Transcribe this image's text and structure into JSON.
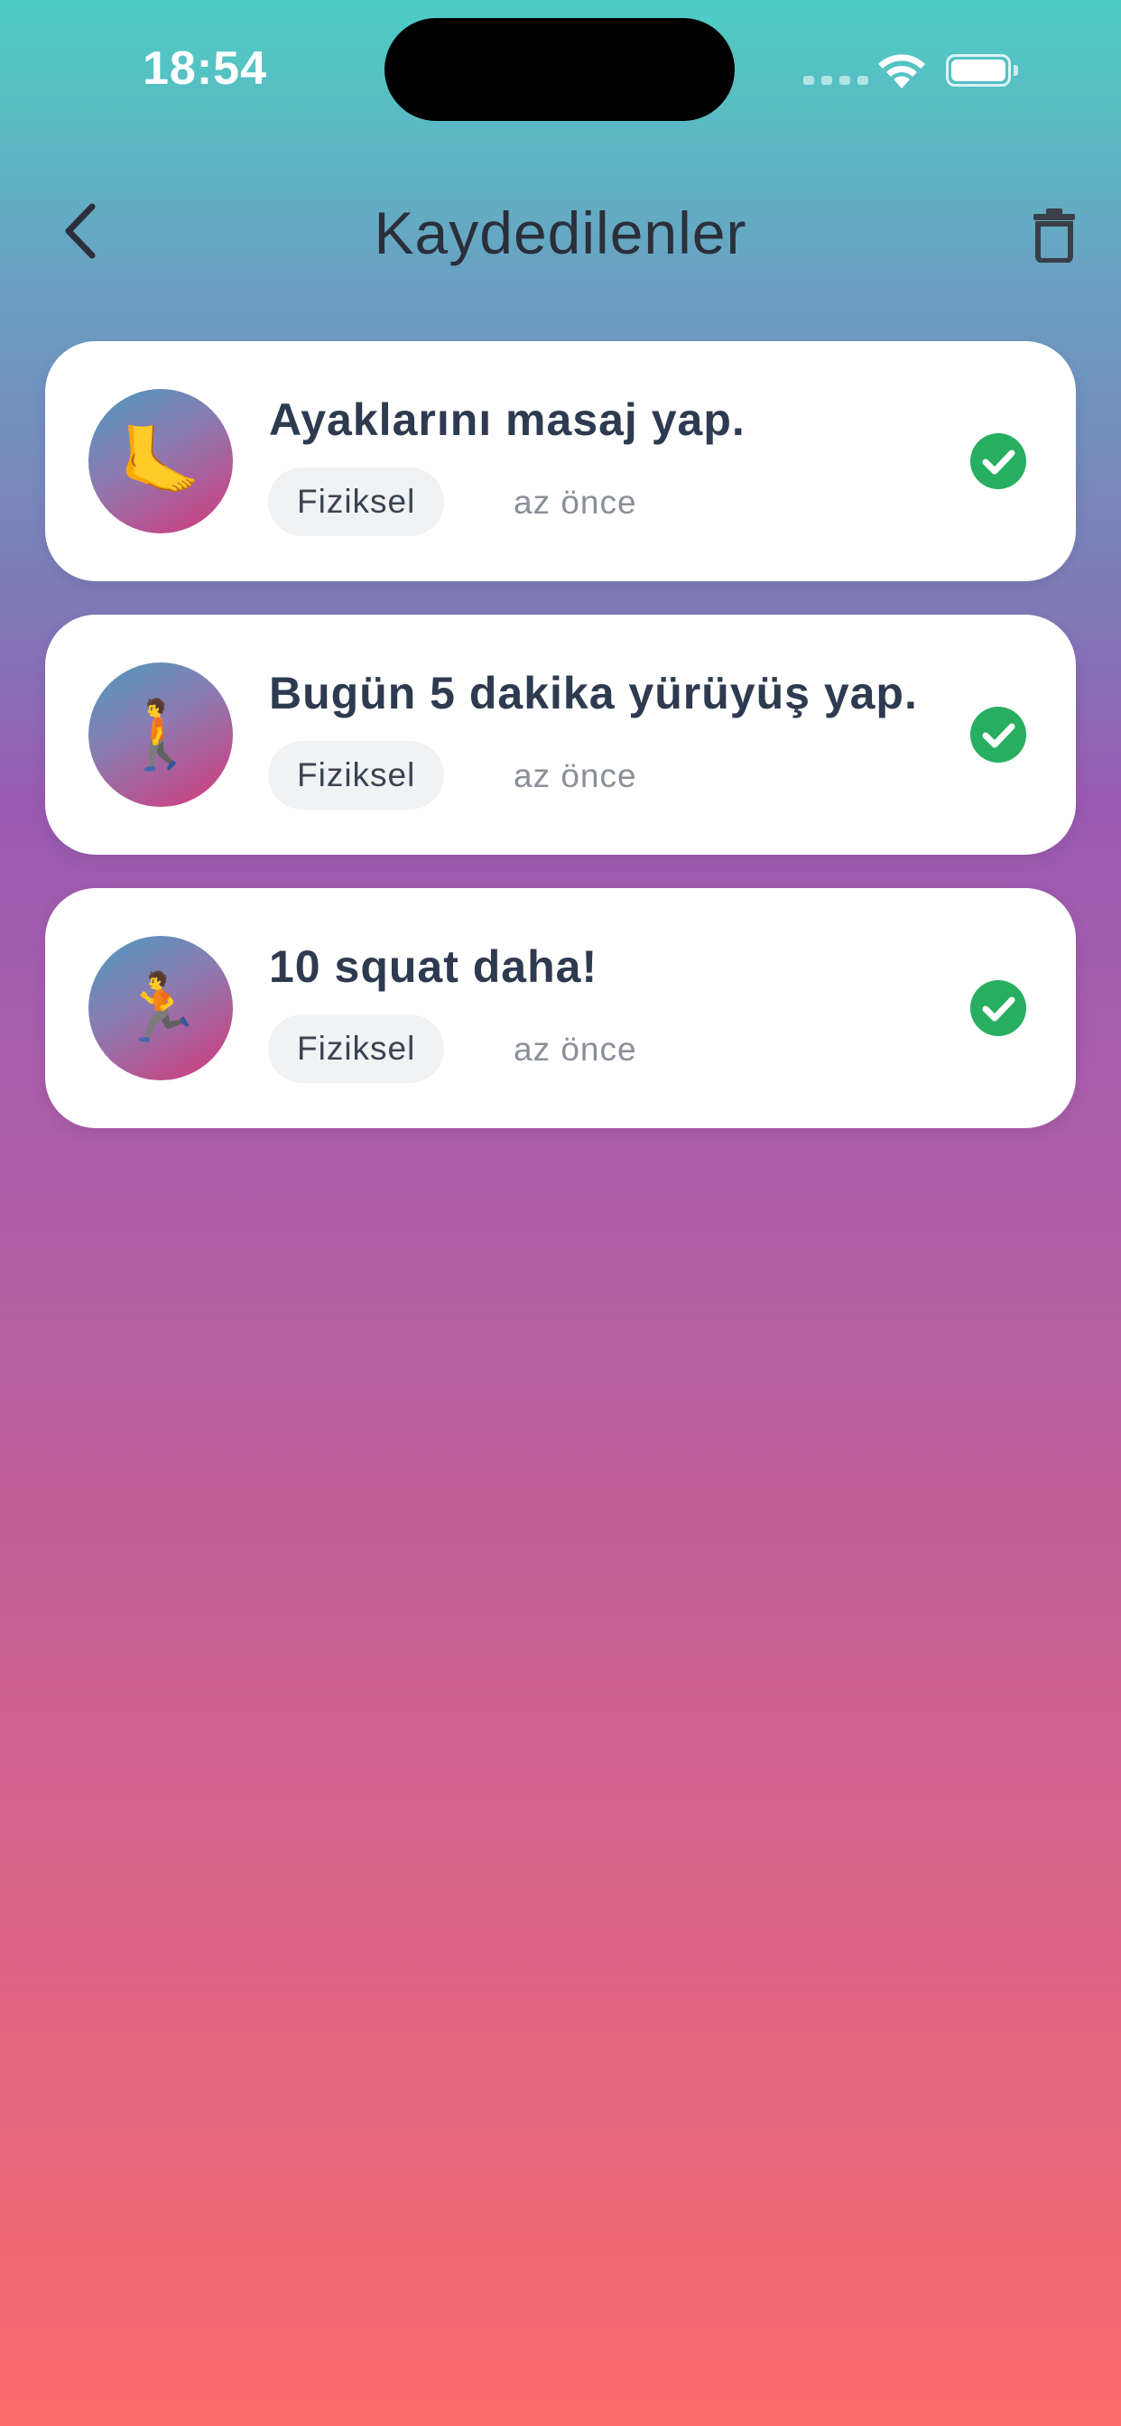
{
  "status_bar": {
    "time": "18:54"
  },
  "header": {
    "title": "Kaydedilenler",
    "back_icon": "chevron-left-icon",
    "trash_icon": "trash-icon"
  },
  "colors": {
    "check_green": "#27ae60",
    "text_dark": "#2e3a4f",
    "gradient_top": "#4ecdc4",
    "gradient_bottom": "#fd6b6b"
  },
  "items": [
    {
      "emoji": "🦶",
      "title": "Ayaklarını masaj yap.",
      "category": "Fiziksel",
      "time": "az önce",
      "done": true
    },
    {
      "emoji": "🚶",
      "title": "Bugün 5 dakika yürüyüş yap.",
      "category": "Fiziksel",
      "time": "az önce",
      "done": true
    },
    {
      "emoji": "🏃",
      "title": "10 squat daha!",
      "category": "Fiziksel",
      "time": "az önce",
      "done": true
    }
  ]
}
